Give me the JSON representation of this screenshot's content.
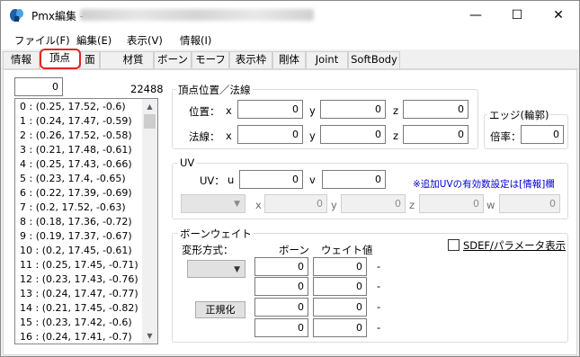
{
  "window": {
    "title": "Pmx編集 -",
    "icon_name": "pmx-app-icon",
    "minimize_glyph": "—",
    "maximize_glyph": "☐",
    "close_glyph": "✕"
  },
  "menubar": {
    "items": [
      {
        "label": "ファイル(F)"
      },
      {
        "label": "編集(E)"
      },
      {
        "label": "表示(V)"
      },
      {
        "label": "情報(I)"
      }
    ]
  },
  "tabs": [
    {
      "label": "情報"
    },
    {
      "label": "頂点"
    },
    {
      "label": "面"
    },
    {
      "label": "材質"
    },
    {
      "label": "ボーン"
    },
    {
      "label": "モーフ"
    },
    {
      "label": "表示枠"
    },
    {
      "label": "剛体"
    },
    {
      "label": "Joint"
    },
    {
      "label": "SoftBody"
    }
  ],
  "active_tab": "頂点",
  "highlight_color": "#e0261f",
  "vertex_list": {
    "index_value": "0",
    "count": "22488",
    "items": [
      "0 : (0.25, 17.52, -0.6)",
      "1 : (0.24, 17.47, -0.59)",
      "2 : (0.26, 17.52, -0.58)",
      "3 : (0.21, 17.48, -0.61)",
      "4 : (0.25, 17.43, -0.66)",
      "5 : (0.23, 17.4, -0.65)",
      "6 : (0.22, 17.39, -0.69)",
      "7 : (0.2, 17.52, -0.63)",
      "8 : (0.18, 17.36, -0.72)",
      "9 : (0.19, 17.37, -0.67)",
      "10 : (0.2, 17.45, -0.61)",
      "11 : (0.25, 17.45, -0.71)",
      "12 : (0.23, 17.43, -0.76)",
      "13 : (0.24, 17.47, -0.77)",
      "14 : (0.21, 17.45, -0.82)",
      "15 : (0.23, 17.42, -0.6)",
      "16 : (0.24, 17.41, -0.7)"
    ]
  },
  "position_group": {
    "title": "頂点位置／法線",
    "position_label": "位置：",
    "normal_label": "法線：",
    "x_label": "x",
    "y_label": "y",
    "z_label": "z",
    "position": {
      "x": "0",
      "y": "0",
      "z": "0"
    },
    "normal": {
      "x": "0",
      "y": "0",
      "z": "0"
    }
  },
  "edge_group": {
    "title": "エッジ(輪郭)",
    "ratio_label": "倍率：",
    "ratio_value": "0"
  },
  "uv_group": {
    "title": "UV",
    "uv_label": "UV：",
    "u_label": "u",
    "v_label": "v",
    "u_value": "0",
    "v_value": "0",
    "note": "※追加UVの有効数設定は[情報]欄",
    "x_label": "x",
    "y_label": "y",
    "z_label": "z",
    "w_label": "w",
    "add_x": "0",
    "add_y": "0",
    "add_z": "0",
    "add_w": "0"
  },
  "bone_group": {
    "title": "ボーンウェイト",
    "deform_label": "変形方式：",
    "bone_header": "ボーン",
    "weight_header": "ウェイト値",
    "normalize_label": "正規化",
    "sdef_label": "SDEF/パラメータ表示",
    "rows": [
      {
        "bone": "0",
        "weight": "0",
        "dash": "-"
      },
      {
        "bone": "0",
        "weight": "0",
        "dash": "-"
      },
      {
        "bone": "0",
        "weight": "0",
        "dash": "-"
      },
      {
        "bone": "0",
        "weight": "0",
        "dash": "-"
      }
    ]
  }
}
